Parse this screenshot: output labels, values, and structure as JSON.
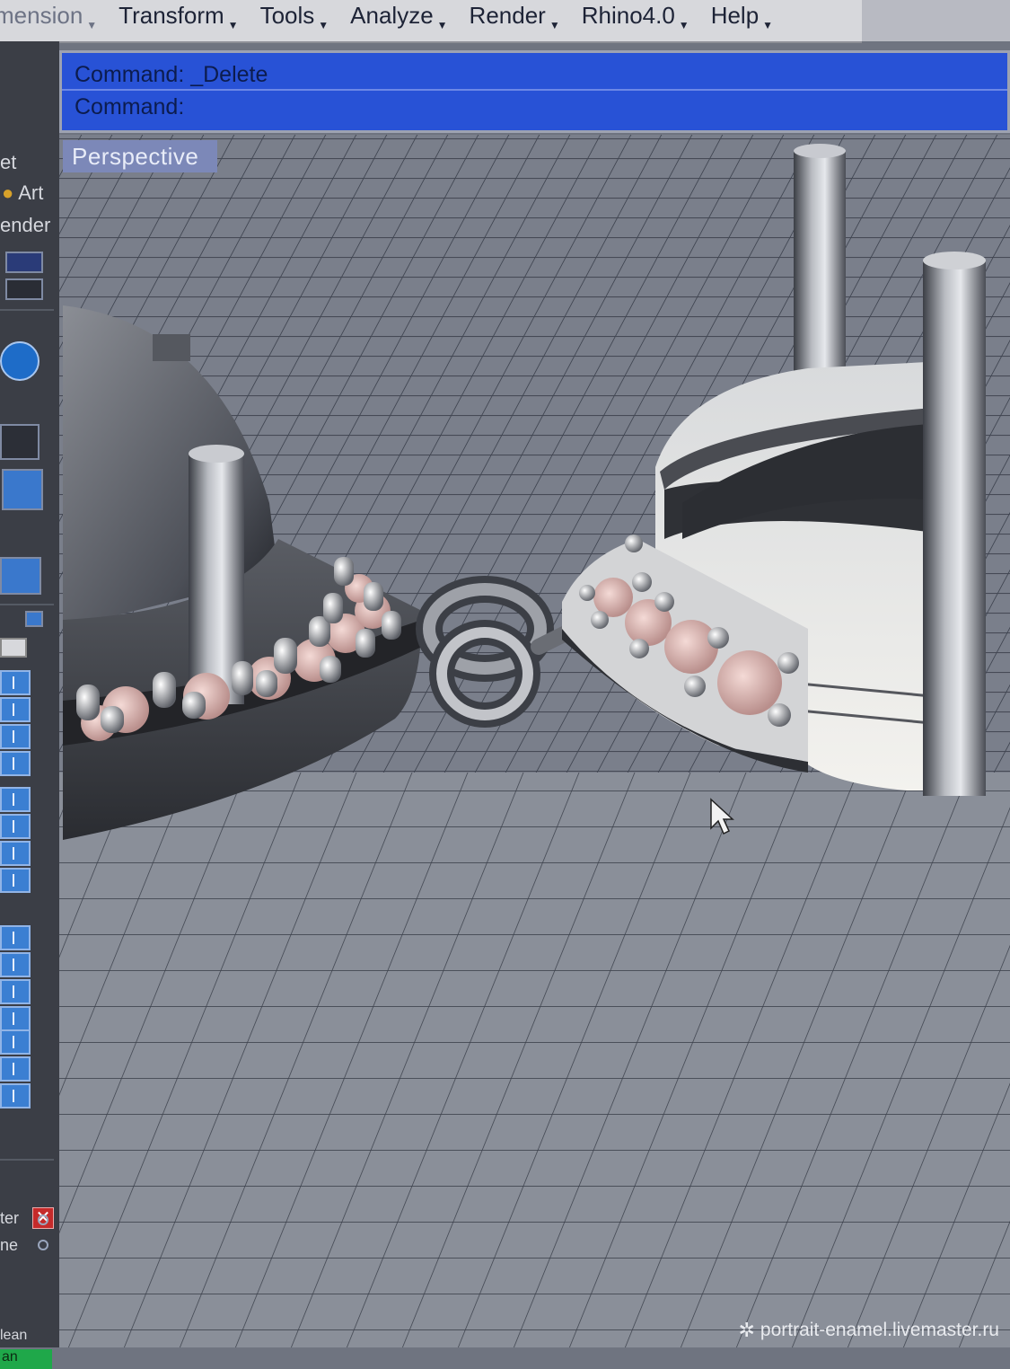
{
  "menubar": {
    "items": [
      {
        "label": "mension",
        "key": "dimension"
      },
      {
        "label": "Transform",
        "key": "transform"
      },
      {
        "label": "Tools",
        "key": "tools"
      },
      {
        "label": "Analyze",
        "key": "analyze"
      },
      {
        "label": "Render",
        "key": "render"
      },
      {
        "label": "Rhino4.0",
        "key": "rhino"
      },
      {
        "label": "Help",
        "key": "help"
      }
    ]
  },
  "command": {
    "line1": "Command: _Delete",
    "line2": "Command:"
  },
  "viewport": {
    "title": "Perspective"
  },
  "left_panel": {
    "label_top": "et",
    "label_art": "Art",
    "label_render": "ender",
    "label_bottom_1": "ter",
    "label_bottom_2": "ne",
    "label_bottom_3": "an",
    "label_bottom_4": "lean",
    "close_symbol": "✕"
  },
  "watermark": {
    "text": "portrait-enamel.livemaster.ru",
    "icon": "gear-icon"
  },
  "colors": {
    "command_bg": "#2852d6",
    "menu_bg": "#d7d8dc",
    "panel_bg": "#3b3e46",
    "grid": "#6f7480"
  }
}
